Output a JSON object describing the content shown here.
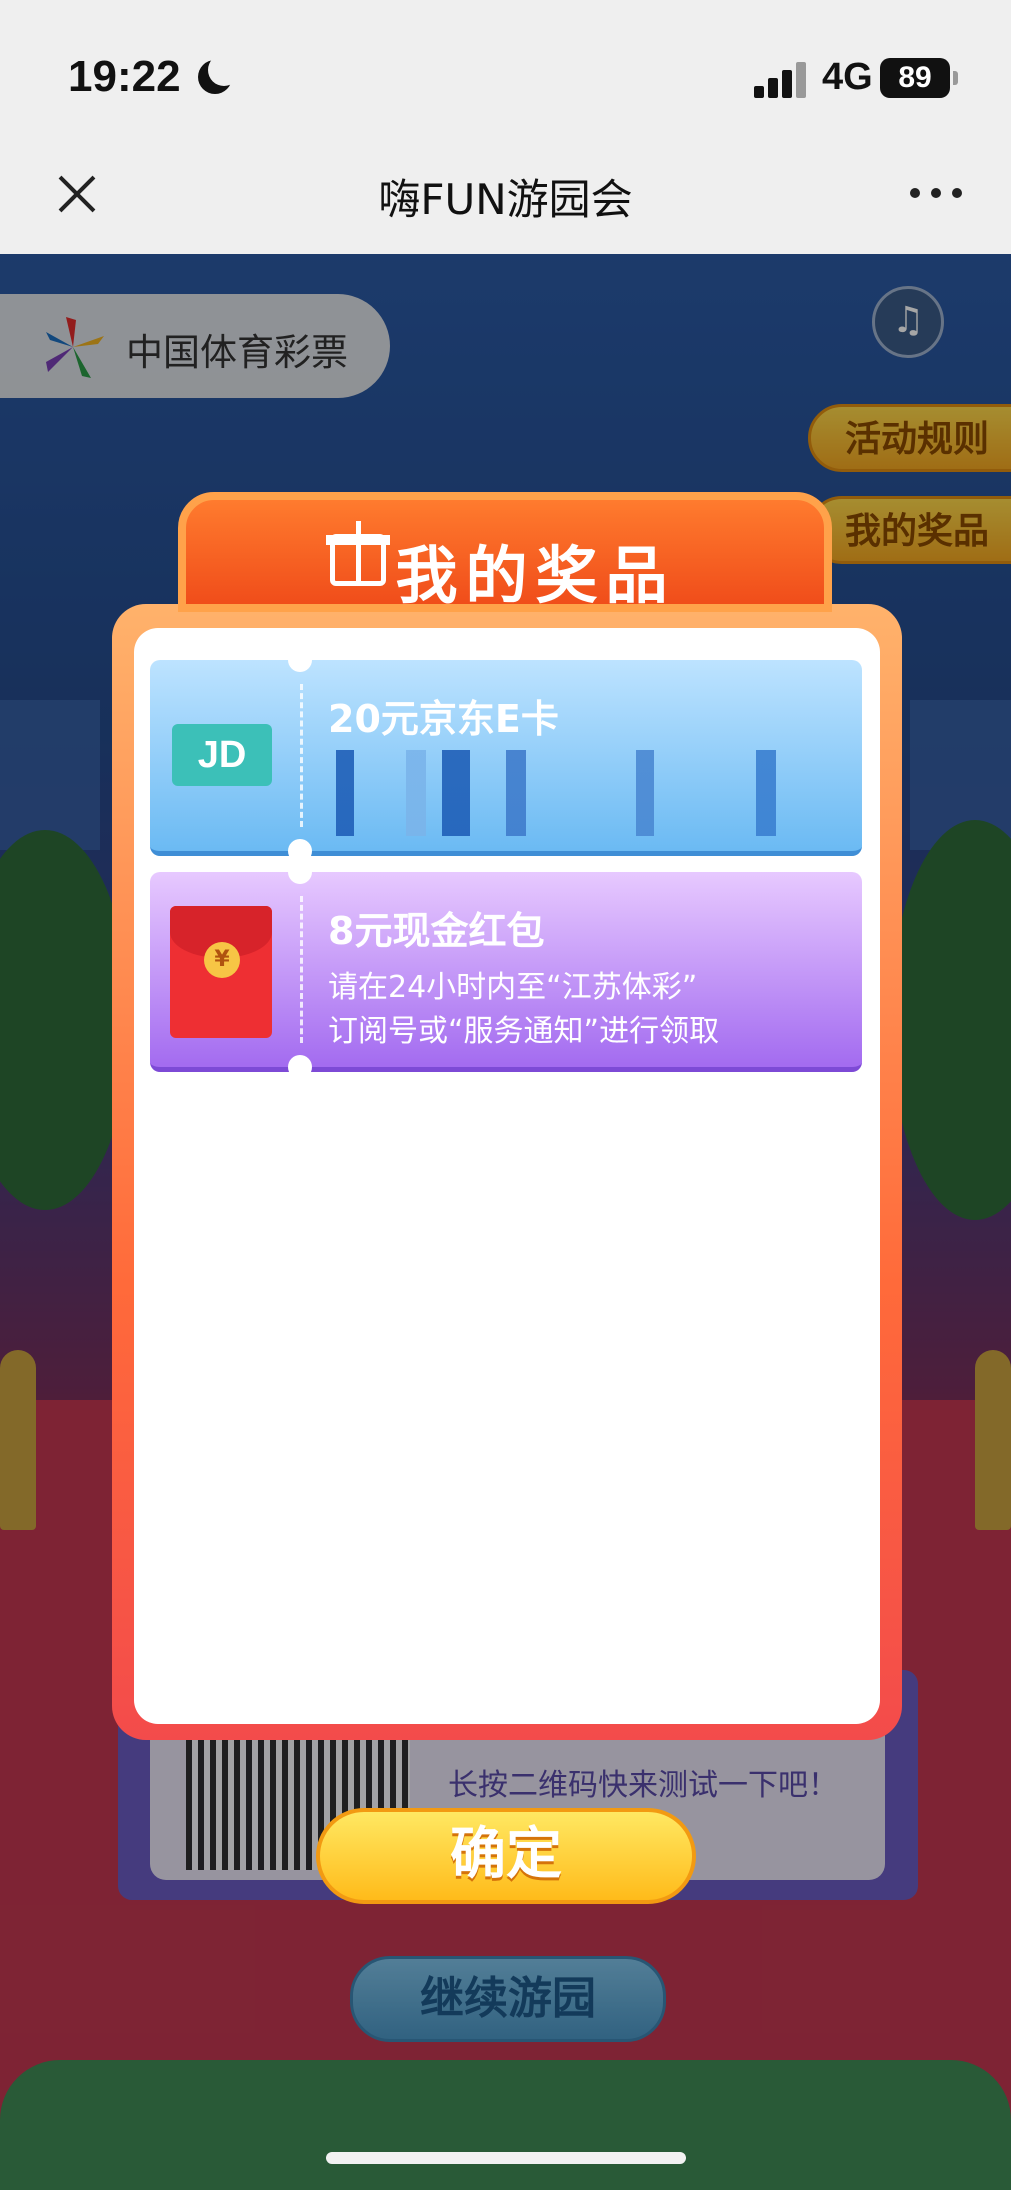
{
  "status_bar": {
    "time": "19:22",
    "network": "4G",
    "battery": "89"
  },
  "title_bar": {
    "title": "嗨FUN游园会"
  },
  "logo": {
    "text": "中国体育彩票"
  },
  "side_tabs": [
    "活动规则",
    "我的奖品"
  ],
  "modal": {
    "title": "我的奖品",
    "prizes": [
      {
        "title": "20元京东E卡",
        "icon": "jd-card-icon",
        "jd_text": "JD"
      },
      {
        "title": "8元现金红包",
        "icon": "red-packet-icon",
        "desc_line1": "请在24小时内至“江苏体彩”",
        "desc_line2": "订阅号或“服务通知”进行领取",
        "coin": "¥"
      }
    ],
    "confirm_label": "确定"
  },
  "background": {
    "hint_text": "长按二维码快来测试一下吧！",
    "continue_label": "继续游园"
  },
  "colors": {
    "accent_orange": "#f04d1a",
    "button_yellow": "#ffbb1a",
    "prize_blue": "#6bbaf3",
    "prize_purple": "#a36bf0"
  }
}
